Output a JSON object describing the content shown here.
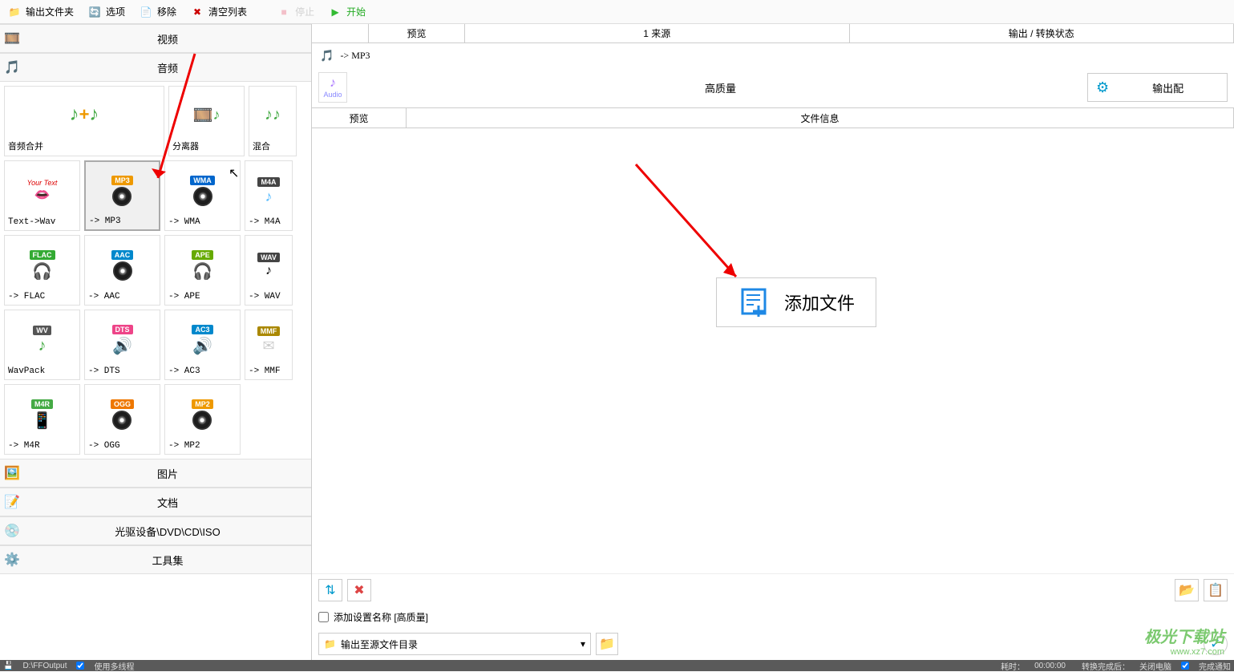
{
  "toolbar": {
    "output_folder": "输出文件夹",
    "options": "选项",
    "remove": "移除",
    "clear_list": "清空列表",
    "stop": "停止",
    "start": "开始"
  },
  "categories": {
    "video": "视频",
    "audio": "音频",
    "image": "图片",
    "document": "文档",
    "optical": "光驱设备\\DVD\\CD\\ISO",
    "tools": "工具集"
  },
  "tiles": {
    "audio_merge": "音频合并",
    "splitter": "分离器",
    "mix": "混合",
    "text_wav": "Text->Wav",
    "mp3": "-> MP3",
    "wma": "-> WMA",
    "m4a": "-> M4A",
    "flac": "-> FLAC",
    "aac": "-> AAC",
    "ape": "-> APE",
    "wav": "-> WAV",
    "wavpack": "WavPack",
    "dts": "-> DTS",
    "ac3": "-> AC3",
    "mmf": "-> MMF",
    "m4r": "-> M4R",
    "ogg": "-> OGG",
    "mp2": "-> MP2"
  },
  "badges": {
    "mp3": "MP3",
    "wma": "WMA",
    "m4a": "M4A",
    "flac": "FLAC",
    "aac": "AAC",
    "ape": "APE",
    "wav": "WAV",
    "wv": "WV",
    "dts": "DTS",
    "ac3": "AC3",
    "mmf": "MMF",
    "m4r": "M4R",
    "ogg": "OGG",
    "mp2": "MP2"
  },
  "tabs": {
    "preview": "预览",
    "source": "1 来源",
    "output_status": "输出 / 转换状态"
  },
  "format_path": "-> MP3",
  "audio_badge": "Audio",
  "quality": "高质量",
  "output_config": "输出配",
  "subtabs": {
    "preview": "预览",
    "file_info": "文件信息"
  },
  "add_file": "添加文件",
  "settings_name": "添加设置名称 [高质量]",
  "output_dest": "输出至源文件目录",
  "status": {
    "path": "D:\\FFOutput",
    "multithread": "使用多线程",
    "elapsed_label": "耗时：",
    "elapsed_time": "00:00:00",
    "after_label": "转换完成后：",
    "after_action": "关闭电脑",
    "notify": "完成通知"
  },
  "watermark": {
    "site": "极光下载站",
    "url": "www.xz7.com"
  },
  "your_text": "Your Text"
}
